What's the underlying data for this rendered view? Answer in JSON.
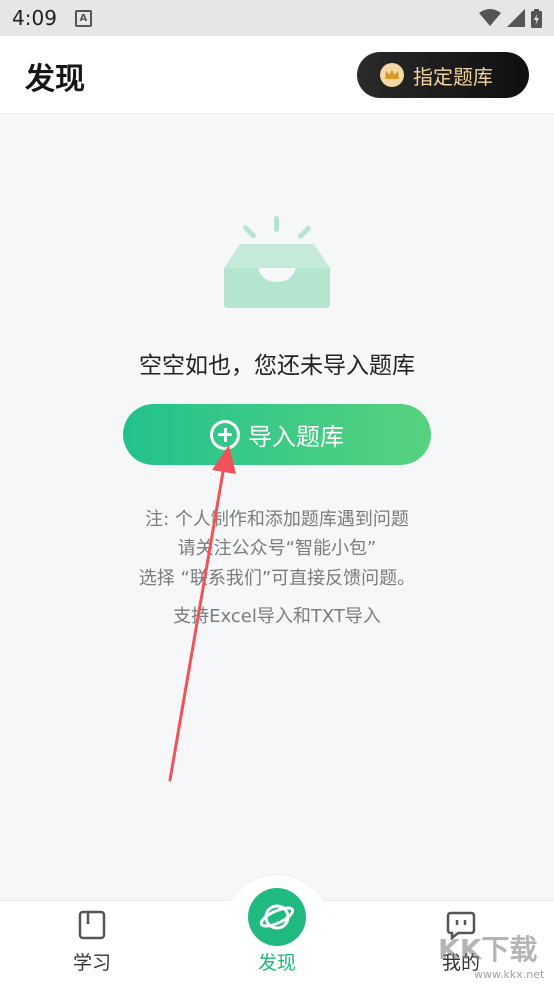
{
  "status_bar": {
    "time": "4:09",
    "notification_icon": "A"
  },
  "header": {
    "title": "发现",
    "bank_button_label": "指定题库"
  },
  "empty_state": {
    "message": "空空如也，您还未导入题库"
  },
  "import_button": {
    "label": "导入题库"
  },
  "notes": {
    "line1": "注: 个人制作和添加题库遇到问题",
    "line2": "请关注公众号“智能小包”",
    "line3": "选择 “联系我们”可直接反馈问题。",
    "line4": "支持Excel导入和TXT导入"
  },
  "tabbar": {
    "study": "学习",
    "discover": "发现",
    "mine": "我的"
  },
  "watermark": {
    "text": "KK下载",
    "url": "www.kkx.net"
  },
  "colors": {
    "accent": "#22c28c",
    "accent_end": "#57d27f",
    "arrow": "#f0525a",
    "gold": "#f2d3a0",
    "illustration": "#b4e5cf"
  },
  "icons": {
    "status": [
      "wifi-icon",
      "signal-icon",
      "battery-icon"
    ],
    "crown": "crown-icon",
    "empty": "empty-inbox-icon",
    "plus": "plus-circle-icon",
    "study": "book-icon",
    "discover": "planet-icon",
    "mine": "chat-face-icon"
  }
}
